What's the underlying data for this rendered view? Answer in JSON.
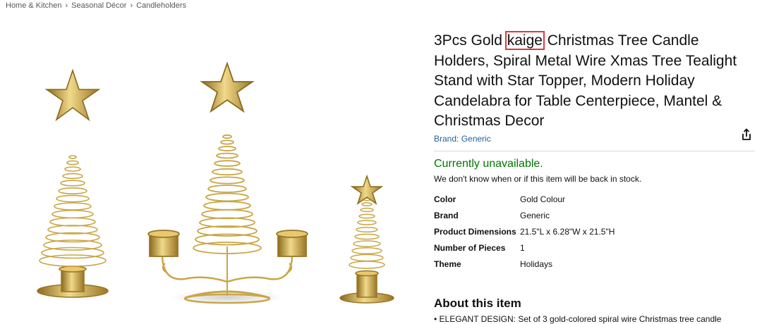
{
  "breadcrumb": [
    "Home & Kitchen",
    "Seasonal Décor",
    "Candleholders"
  ],
  "breadcrumb_sep": "›",
  "product": {
    "title_before": "3Pcs Gold ",
    "title_highlight": "kaige",
    "title_after": " Christmas Tree Candle Holders, Spiral Metal Wire Xmas Tree Tealight Stand with Star Topper, Modern Holiday Candelabra for Table Centerpiece, Mantel & Christmas Decor",
    "brand_link": "Brand: Generic",
    "availability": "Currently unavailable.",
    "stock_note": "We don't know when or if this item will be back in stock."
  },
  "specs": [
    {
      "key": "Color",
      "value": "Gold Colour"
    },
    {
      "key": "Brand",
      "value": "Generic"
    },
    {
      "key": "Product Dimensions",
      "value": "21.5\"L x 6.28\"W x 21.5\"H"
    },
    {
      "key": "Number of Pieces",
      "value": "1"
    },
    {
      "key": "Theme",
      "value": "Holidays"
    }
  ],
  "about": {
    "title": "About this item",
    "first_bullet": "• ELEGANT DESIGN: Set of 3 gold-colored spiral wire Christmas tree candle"
  },
  "colors": {
    "highlight": "#e0373f",
    "link": "#2162a1",
    "availability": "#007600",
    "gold": "#c9a646"
  },
  "icons": {
    "share": "share-icon"
  }
}
